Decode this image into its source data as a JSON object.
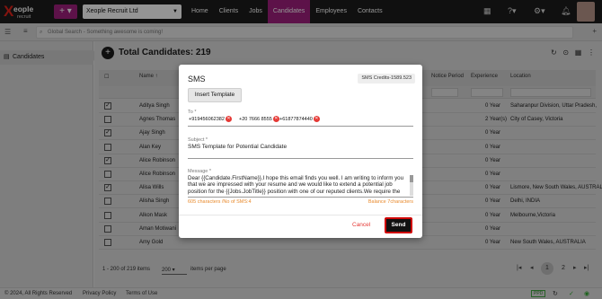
{
  "topbar": {
    "logo_mark": "X",
    "logo_word": "eople",
    "logo_sub": "recruit",
    "plus_label": "+ ▾",
    "company": "Xeople Recruit Ltd",
    "nav": [
      "Home",
      "Clients",
      "Jobs",
      "Candidates",
      "Employees",
      "Contacts"
    ],
    "active_nav": "Candidates"
  },
  "search": {
    "placeholder": "Global Search - Something awesome is coming!"
  },
  "sidebar": {
    "item": "Candidates"
  },
  "main": {
    "total_label": "Total Candidates: 219",
    "columns": {
      "name": "Name ↑",
      "notice": "Notice Period",
      "experience": "Experience",
      "location": "Location"
    },
    "rows": [
      {
        "name": "Aditya Singh",
        "checked": true,
        "exp": "0 Year",
        "loc": "Saharanpur Division, Uttar Pradesh,"
      },
      {
        "name": "Agnes Thomas",
        "checked": false,
        "exp": "2 Year(s)",
        "loc": "City of Casey, Victoria"
      },
      {
        "name": "Ajay Singh",
        "checked": true,
        "exp": "0 Year",
        "loc": ""
      },
      {
        "name": "Alan Key",
        "checked": false,
        "exp": "0 Year",
        "loc": ""
      },
      {
        "name": "Alice Robinson",
        "checked": true,
        "exp": "0 Year",
        "loc": ""
      },
      {
        "name": "Alice Robinson",
        "checked": false,
        "exp": "0 Year",
        "loc": ""
      },
      {
        "name": "Alisa Wills",
        "checked": true,
        "exp": "0 Year",
        "loc": "Lismore, New South Wales, AUSTRAL"
      },
      {
        "name": "Alisha Singh",
        "checked": false,
        "exp": "0 Year",
        "loc": "Delhi, INDIA"
      },
      {
        "name": "Alkon Mask",
        "checked": false,
        "exp": "0 Year",
        "loc": "Melbourne,Victoria"
      },
      {
        "name": "Aman Motiwani",
        "checked": false,
        "exp": "0 Year",
        "loc": ""
      },
      {
        "name": "Amy Gold",
        "checked": false,
        "exp": "0 Year",
        "loc": "New South Wales, AUSTRALIA"
      }
    ],
    "pager": {
      "range": "1 - 200 of 219 items",
      "per_page_value": "200",
      "per_page_label": "items per page",
      "pages": [
        "1",
        "2"
      ],
      "current": "1"
    }
  },
  "footer": {
    "copyright": "© 2024, All Rights Reserved",
    "privacy": "Privacy Policy",
    "terms": "Terms of Use",
    "badge": "PPD"
  },
  "modal": {
    "title": "SMS",
    "credits": "SMS Credits-1589.523",
    "insert_template": "Insert Template",
    "to_label": "To *",
    "recipients": [
      "+919456062382",
      "+20 7666 8555",
      "+61877874440"
    ],
    "subject_label": "Subject *",
    "subject_value": "SMS Template for Potential Candidate",
    "message_label": "Message *",
    "message_value": "Dear {{Candidate.FirstName}},I hope this email finds you well. I am writing to inform you that we are impressed with your resume and we would like to extend a potential job position for the {{Jobs.JobTitle}} position with one of our reputed clients.We require the",
    "char_count": "605 characters /No of SMS:4",
    "balance": "Balance 7characters",
    "cancel": "Cancel",
    "send": "Send"
  },
  "colors": {
    "brand": "#a0207e",
    "topbar": "#1c1c1c",
    "counter": "#e8892b",
    "send_border": "#d00000"
  }
}
